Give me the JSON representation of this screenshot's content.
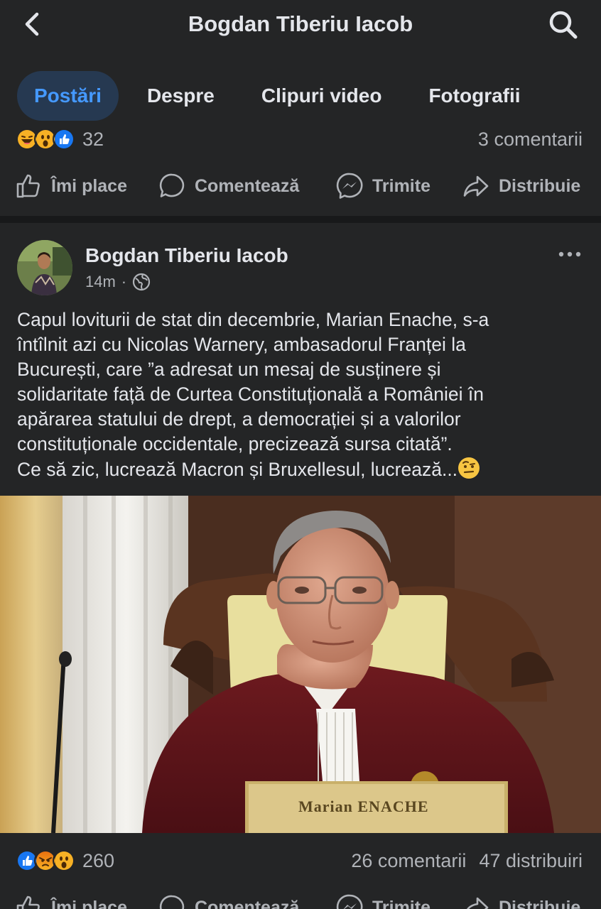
{
  "header": {
    "title": "Bogdan Tiberiu Iacob",
    "back_icon": "chevron-left-icon",
    "search_icon": "search-icon"
  },
  "tabs": [
    {
      "label": "Postări",
      "active": true
    },
    {
      "label": "Despre",
      "active": false
    },
    {
      "label": "Clipuri video",
      "active": false
    },
    {
      "label": "Fotografii",
      "active": false
    }
  ],
  "previous_post": {
    "reactions": [
      "haha",
      "wow",
      "like"
    ],
    "reaction_count": "32",
    "comments": "3 comentarii",
    "actions": [
      {
        "label": "Îmi place",
        "icon": "like-icon"
      },
      {
        "label": "Comentează",
        "icon": "comment-icon"
      },
      {
        "label": "Trimite",
        "icon": "messenger-icon"
      },
      {
        "label": "Distribuie",
        "icon": "share-icon"
      }
    ]
  },
  "post": {
    "author": "Bogdan Tiberiu Iacob",
    "time": "14m",
    "separator": "·",
    "audience_icon": "globe-icon",
    "text_lines": [
      "Capul loviturii de stat din decembrie, Marian Enache, s-a",
      "întîlnit azi cu Nicolas Warnery, ambasadorul Franței la",
      "București, care ”a adresat un mesaj de susținere și",
      "solidaritate față de Curtea Constituțională a României în",
      "apărarea statului de drept, a democrației și a valorilor",
      "constituționale occidentale, precizează sursa citată”.",
      "Ce să zic, lucrează Macron și Bruxellesul, lucrează..."
    ],
    "trailing_emoji": "raised-eyebrow-emoji",
    "photo_nameplate": "Marian ENACHE",
    "reactions": [
      "like",
      "angry",
      "wow"
    ],
    "reaction_count": "260",
    "comments": "26 comentarii",
    "shares": "47 distribuiri",
    "actions": [
      {
        "label": "Îmi place"
      },
      {
        "label": "Comentează"
      },
      {
        "label": "Trimite"
      },
      {
        "label": "Distribuie"
      }
    ]
  },
  "colors": {
    "background": "#242526",
    "divider": "#18191a",
    "text_primary": "#e4e6eb",
    "text_secondary": "#b0b3b8",
    "accent": "#4599ff",
    "active_tab_bg": "#263951"
  }
}
